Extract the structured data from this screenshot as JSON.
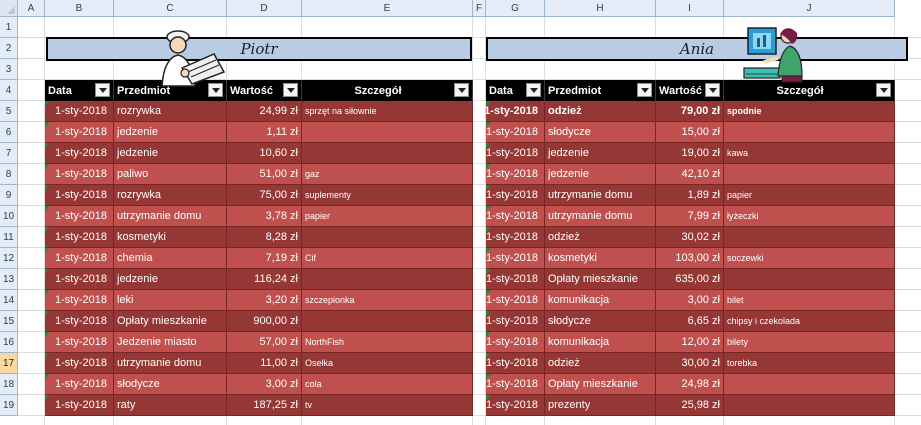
{
  "columns": [
    "A",
    "B",
    "C",
    "D",
    "E",
    "F",
    "G",
    "H",
    "I",
    "J"
  ],
  "rows": [
    "1",
    "2",
    "3",
    "4",
    "5",
    "6",
    "7",
    "8",
    "9",
    "10",
    "11",
    "12",
    "13",
    "14",
    "15",
    "16",
    "17",
    "18",
    "19"
  ],
  "selected_row": "17",
  "colors": {
    "odd_row": "#953735",
    "even_row": "#c0504d",
    "header_bg": "#000000",
    "name_box": "#b8cce4"
  },
  "headers": {
    "date": "Data",
    "item": "Przedmiot",
    "value": "Wartość",
    "detail": "Szczegół"
  },
  "tables": [
    {
      "name": "Piotr",
      "clipart": "architect-with-blueprint-clipart",
      "rows": [
        {
          "date": "1-sty-2018",
          "item": "rozrywka",
          "value": "24,99 zł",
          "detail": "sprzęt na siłownie"
        },
        {
          "date": "1-sty-2018",
          "item": "jedzenie",
          "value": "1,11 zł",
          "detail": ""
        },
        {
          "date": "1-sty-2018",
          "item": "jedzenie",
          "value": "10,60 zł",
          "detail": ""
        },
        {
          "date": "1-sty-2018",
          "item": "paliwo",
          "value": "51,00 zł",
          "detail": "gaz"
        },
        {
          "date": "1-sty-2018",
          "item": "rozrywka",
          "value": "75,00 zł",
          "detail": "suplementy"
        },
        {
          "date": "1-sty-2018",
          "item": "utrzymanie domu",
          "value": "3,78 zł",
          "detail": "papier"
        },
        {
          "date": "1-sty-2018",
          "item": "kosmetyki",
          "value": "8,28 zł",
          "detail": ""
        },
        {
          "date": "1-sty-2018",
          "item": "chemia",
          "value": "7,19 zł",
          "detail": "Cif"
        },
        {
          "date": "1-sty-2018",
          "item": "jedzenie",
          "value": "116,24 zł",
          "detail": ""
        },
        {
          "date": "1-sty-2018",
          "item": "leki",
          "value": "3,20 zł",
          "detail": "szczepionka"
        },
        {
          "date": "1-sty-2018",
          "item": "Opłaty mieszkanie",
          "value": "900,00 zł",
          "detail": ""
        },
        {
          "date": "1-sty-2018",
          "item": "Jedzenie miasto",
          "value": "57,00 zł",
          "detail": "NorthFish"
        },
        {
          "date": "1-sty-2018",
          "item": "utrzymanie domu",
          "value": "11,00 zł",
          "detail": "Osełka"
        },
        {
          "date": "1-sty-2018",
          "item": "słodycze",
          "value": "3,00 zł",
          "detail": "cola"
        },
        {
          "date": "1-sty-2018",
          "item": "raty",
          "value": "187,25 zł",
          "detail": "tv"
        }
      ]
    },
    {
      "name": "Ania",
      "clipart": "woman-at-computer-clipart",
      "rows": [
        {
          "date": "1-sty-2018",
          "item": "odzież",
          "value": "79,00 zł",
          "detail": "spodnie",
          "bold": true
        },
        {
          "date": "1-sty-2018",
          "item": "słodycze",
          "value": "15,00 zł",
          "detail": ""
        },
        {
          "date": "1-sty-2018",
          "item": "jedzenie",
          "value": "19,00 zł",
          "detail": "kawa"
        },
        {
          "date": "1-sty-2018",
          "item": "jedzenie",
          "value": "42,10 zł",
          "detail": ""
        },
        {
          "date": "1-sty-2018",
          "item": "utrzymanie domu",
          "value": "1,89 zł",
          "detail": "papier"
        },
        {
          "date": "1-sty-2018",
          "item": "utrzymanie domu",
          "value": "7,99 zł",
          "detail": "łyżeczki"
        },
        {
          "date": "1-sty-2018",
          "item": "odzież",
          "value": "30,02 zł",
          "detail": ""
        },
        {
          "date": "1-sty-2018",
          "item": "kosmetyki",
          "value": "103,00 zł",
          "detail": "soczewki"
        },
        {
          "date": "1-sty-2018",
          "item": "Opłaty mieszkanie",
          "value": "635,00 zł",
          "detail": ""
        },
        {
          "date": "1-sty-2018",
          "item": "komunikacja",
          "value": "3,00 zł",
          "detail": "bilet"
        },
        {
          "date": "1-sty-2018",
          "item": "słodycze",
          "value": "6,65 zł",
          "detail": "chipsy i czekolada"
        },
        {
          "date": "1-sty-2018",
          "item": "komunikacja",
          "value": "12,00 zł",
          "detail": "bilety"
        },
        {
          "date": "1-sty-2018",
          "item": "odzież",
          "value": "30,00 zł",
          "detail": "torebka"
        },
        {
          "date": "1-sty-2018",
          "item": "Opłaty mieszkanie",
          "value": "24,98 zł",
          "detail": ""
        },
        {
          "date": "1-sty-2018",
          "item": "prezenty",
          "value": "25,98 zł",
          "detail": ""
        }
      ]
    }
  ]
}
